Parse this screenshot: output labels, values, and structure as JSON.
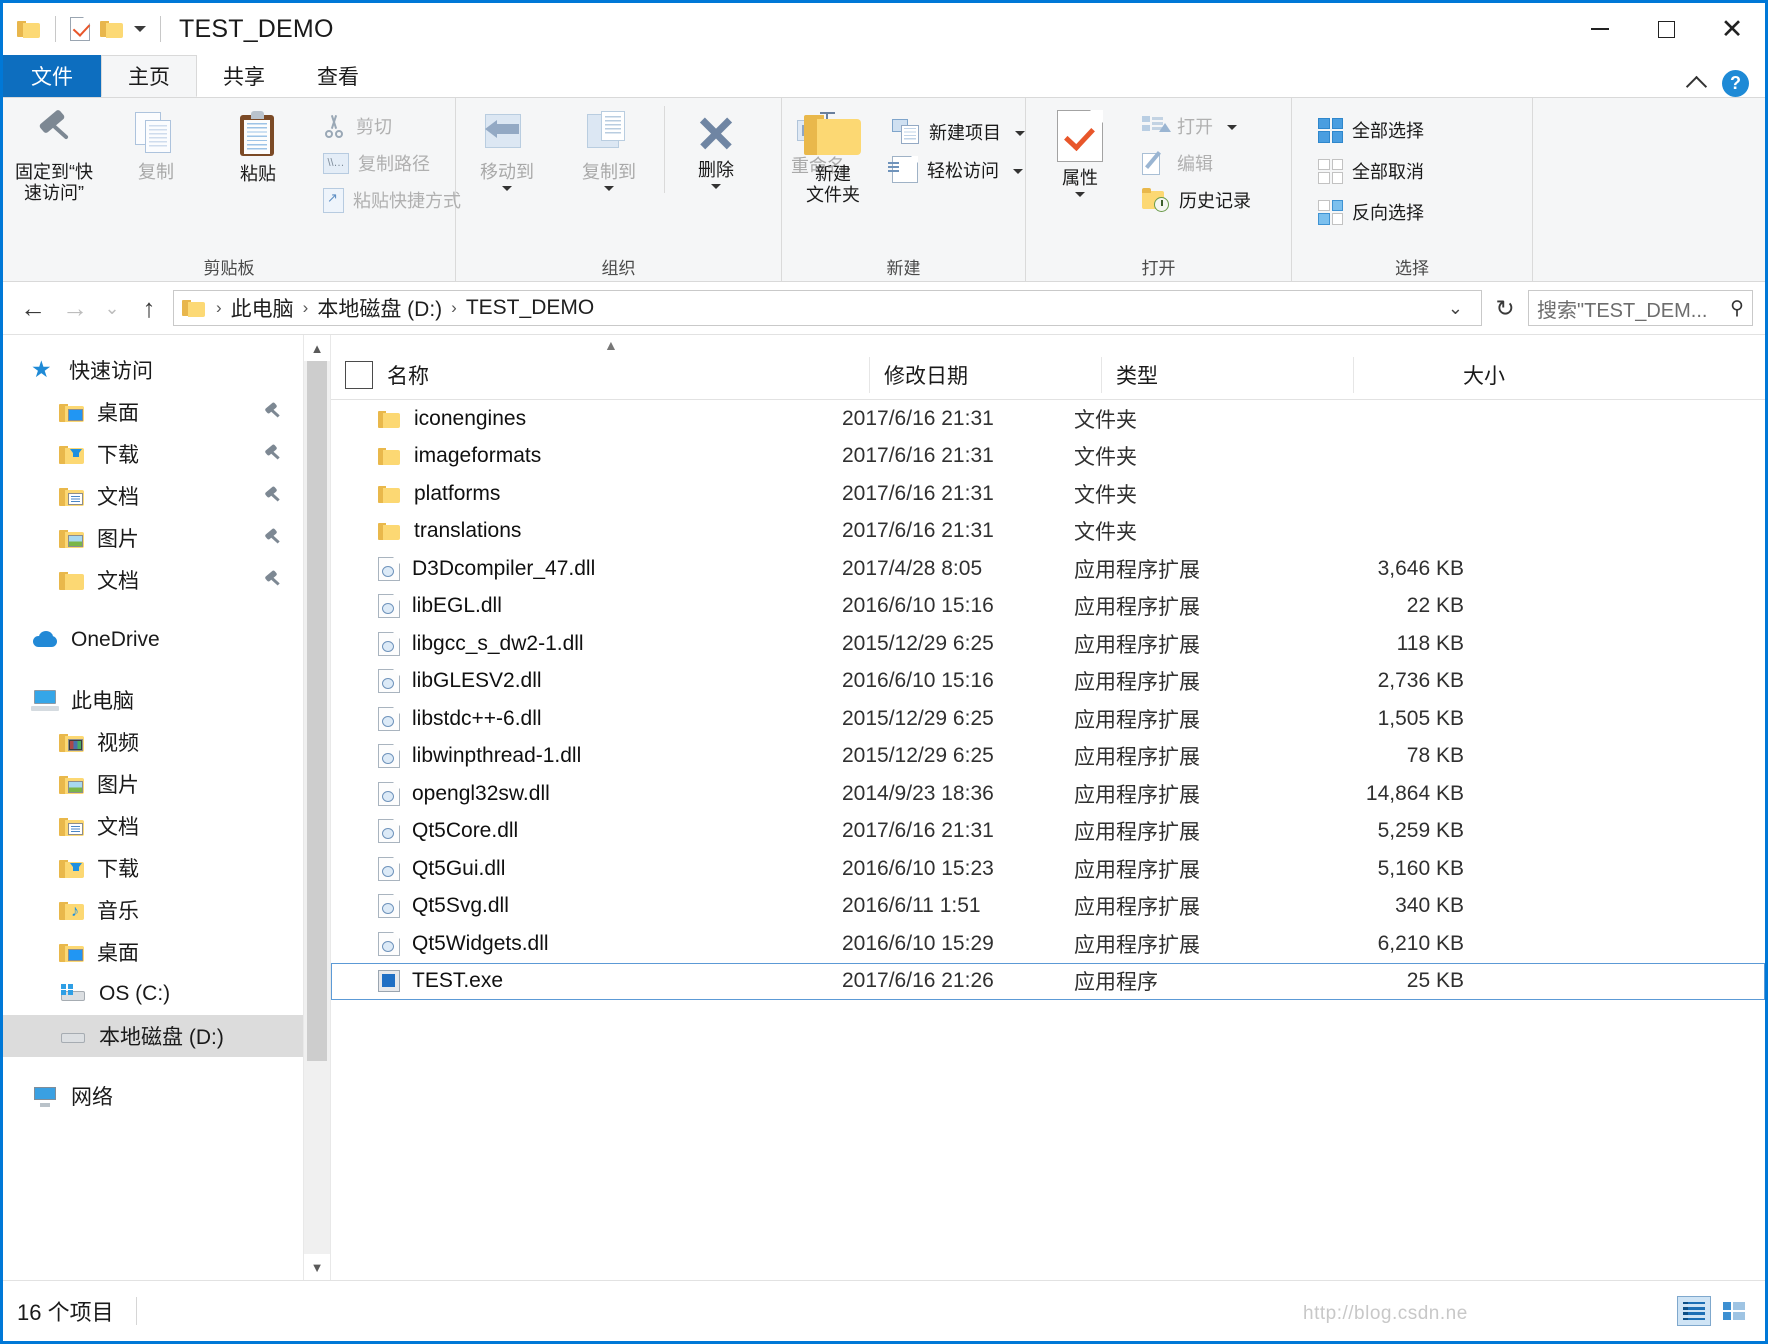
{
  "window": {
    "title": "TEST_DEMO",
    "minimize_label": "最小化",
    "maximize_label": "最大化",
    "close_label": "关闭"
  },
  "quick_access_toolbar": {
    "folder_icon": "folder-icon",
    "properties_icon": "properties-icon",
    "new_folder_icon": "new-folder-icon",
    "customize_label": "▾"
  },
  "tabs": [
    {
      "label": "文件",
      "id": "file"
    },
    {
      "label": "主页",
      "id": "home"
    },
    {
      "label": "共享",
      "id": "share"
    },
    {
      "label": "查看",
      "id": "view"
    }
  ],
  "ribbon": {
    "collapse_icon": "chevron-up-icon",
    "help_icon": "help-icon",
    "help_label": "?",
    "groups": [
      {
        "label": "剪贴板",
        "big_buttons": [
          {
            "label": "固定到“快\n速访问”",
            "line1": "固定到“快",
            "line2": "速访问”",
            "icon": "pin-icon",
            "disabled": false
          },
          {
            "label": "复制",
            "icon": "copy-icon",
            "disabled": true
          },
          {
            "label": "粘贴",
            "icon": "paste-icon",
            "disabled": false
          }
        ],
        "small_buttons": [
          {
            "label": "剪切",
            "icon": "scissors-icon",
            "disabled": true
          },
          {
            "label": "复制路径",
            "icon": "copy-path-icon",
            "disabled": true
          },
          {
            "label": "粘贴快捷方式",
            "icon": "paste-shortcut-icon",
            "disabled": true
          }
        ]
      },
      {
        "label": "组织",
        "big_buttons": [
          {
            "label": "移动到",
            "icon": "move-to-icon",
            "disabled": true,
            "dropdown": true
          },
          {
            "label": "复制到",
            "icon": "copy-to-icon",
            "disabled": true,
            "dropdown": true
          },
          {
            "label": "删除",
            "icon": "delete-icon",
            "disabled": false,
            "dropdown": true
          },
          {
            "label": "重命名",
            "icon": "rename-icon",
            "disabled": true
          }
        ],
        "small_buttons": []
      },
      {
        "label": "新建",
        "big_buttons": [
          {
            "label": "新建\n文件夹",
            "line1": "新建",
            "line2": "文件夹",
            "icon": "new-folder-icon",
            "disabled": false
          }
        ],
        "small_buttons": [
          {
            "label": "新建项目",
            "icon": "new-item-icon",
            "disabled": false,
            "dropdown": true
          },
          {
            "label": "轻松访问",
            "icon": "easy-access-icon",
            "disabled": false,
            "dropdown": true
          }
        ]
      },
      {
        "label": "打开",
        "big_buttons": [
          {
            "label": "属性",
            "icon": "properties-icon",
            "disabled": false,
            "dropdown": true
          }
        ],
        "small_buttons": [
          {
            "label": "打开",
            "icon": "open-icon",
            "disabled": true,
            "dropdown": true
          },
          {
            "label": "编辑",
            "icon": "edit-icon",
            "disabled": true
          },
          {
            "label": "历史记录",
            "icon": "history-icon",
            "disabled": false
          }
        ]
      },
      {
        "label": "选择",
        "big_buttons": [],
        "small_buttons": [
          {
            "label": "全部选择",
            "icon": "select-all-icon",
            "disabled": false
          },
          {
            "label": "全部取消",
            "icon": "select-none-icon",
            "disabled": false
          },
          {
            "label": "反向选择",
            "icon": "invert-selection-icon",
            "disabled": false
          }
        ]
      }
    ]
  },
  "address_bar": {
    "back_icon": "back-arrow-icon",
    "forward_icon": "forward-arrow-icon",
    "recent_icon": "chevron-down-icon",
    "up_icon": "up-arrow-icon",
    "folder_icon": "folder-icon",
    "breadcrumbs": [
      "此电脑",
      "本地磁盘 (D:)",
      "TEST_DEMO"
    ],
    "separator": "›",
    "dropdown_icon": "chevron-down-icon",
    "refresh_icon": "refresh-icon",
    "search_placeholder": "搜索\"TEST_DEM...",
    "search_icon": "search-icon"
  },
  "nav_pane": {
    "scroll_up_icon": "scroll-up-icon",
    "scroll_down_icon": "scroll-down-icon",
    "sections": [
      {
        "header": {
          "label": "快速访问",
          "icon": "star-icon"
        },
        "items": [
          {
            "label": "桌面",
            "icon": "folder-desktop-icon",
            "pinned": true
          },
          {
            "label": "下载",
            "icon": "folder-downloads-icon",
            "pinned": true
          },
          {
            "label": "文档",
            "icon": "folder-documents-icon",
            "pinned": true
          },
          {
            "label": "图片",
            "icon": "folder-pictures-icon",
            "pinned": true
          },
          {
            "label": "文档",
            "icon": "folder-icon",
            "pinned": true
          }
        ]
      },
      {
        "header": {
          "label": "OneDrive",
          "icon": "cloud-icon"
        },
        "items": []
      },
      {
        "header": {
          "label": "此电脑",
          "icon": "computer-icon"
        },
        "items": [
          {
            "label": "视频",
            "icon": "folder-videos-icon",
            "pinned": false
          },
          {
            "label": "图片",
            "icon": "folder-pictures-icon",
            "pinned": false
          },
          {
            "label": "文档",
            "icon": "folder-documents-icon",
            "pinned": false
          },
          {
            "label": "下载",
            "icon": "folder-downloads-icon",
            "pinned": false
          },
          {
            "label": "音乐",
            "icon": "folder-music-icon",
            "pinned": false
          },
          {
            "label": "桌面",
            "icon": "folder-desktop-icon",
            "pinned": false
          },
          {
            "label": "OS (C:)",
            "icon": "drive-os-icon",
            "pinned": false
          },
          {
            "label": "本地磁盘 (D:)",
            "icon": "drive-icon",
            "pinned": false,
            "selected": true
          }
        ]
      },
      {
        "header": {
          "label": "网络",
          "icon": "network-icon"
        },
        "items": []
      }
    ]
  },
  "file_list": {
    "select_all_checkbox": "select-all-checkbox",
    "sort_indicator": "▲",
    "columns": [
      {
        "label": "名称",
        "key": "name"
      },
      {
        "label": "修改日期",
        "key": "date"
      },
      {
        "label": "类型",
        "key": "type"
      },
      {
        "label": "大小",
        "key": "size"
      }
    ],
    "rows": [
      {
        "name": "iconengines",
        "date": "2017/6/16 21:31",
        "type": "文件夹",
        "size": "",
        "icon": "folder-icon",
        "selected": false
      },
      {
        "name": "imageformats",
        "date": "2017/6/16 21:31",
        "type": "文件夹",
        "size": "",
        "icon": "folder-icon",
        "selected": false
      },
      {
        "name": "platforms",
        "date": "2017/6/16 21:31",
        "type": "文件夹",
        "size": "",
        "icon": "folder-icon",
        "selected": false
      },
      {
        "name": "translations",
        "date": "2017/6/16 21:31",
        "type": "文件夹",
        "size": "",
        "icon": "folder-icon",
        "selected": false
      },
      {
        "name": "D3Dcompiler_47.dll",
        "date": "2017/4/28 8:05",
        "type": "应用程序扩展",
        "size": "3,646 KB",
        "icon": "dll-icon",
        "selected": false
      },
      {
        "name": "libEGL.dll",
        "date": "2016/6/10 15:16",
        "type": "应用程序扩展",
        "size": "22 KB",
        "icon": "dll-icon",
        "selected": false
      },
      {
        "name": "libgcc_s_dw2-1.dll",
        "date": "2015/12/29 6:25",
        "type": "应用程序扩展",
        "size": "118 KB",
        "icon": "dll-icon",
        "selected": false
      },
      {
        "name": "libGLESV2.dll",
        "date": "2016/6/10 15:16",
        "type": "应用程序扩展",
        "size": "2,736 KB",
        "icon": "dll-icon",
        "selected": false
      },
      {
        "name": "libstdc++-6.dll",
        "date": "2015/12/29 6:25",
        "type": "应用程序扩展",
        "size": "1,505 KB",
        "icon": "dll-icon",
        "selected": false
      },
      {
        "name": "libwinpthread-1.dll",
        "date": "2015/12/29 6:25",
        "type": "应用程序扩展",
        "size": "78 KB",
        "icon": "dll-icon",
        "selected": false
      },
      {
        "name": "opengl32sw.dll",
        "date": "2014/9/23 18:36",
        "type": "应用程序扩展",
        "size": "14,864 KB",
        "icon": "dll-icon",
        "selected": false
      },
      {
        "name": "Qt5Core.dll",
        "date": "2017/6/16 21:31",
        "type": "应用程序扩展",
        "size": "5,259 KB",
        "icon": "dll-icon",
        "selected": false
      },
      {
        "name": "Qt5Gui.dll",
        "date": "2016/6/10 15:23",
        "type": "应用程序扩展",
        "size": "5,160 KB",
        "icon": "dll-icon",
        "selected": false
      },
      {
        "name": "Qt5Svg.dll",
        "date": "2016/6/11 1:51",
        "type": "应用程序扩展",
        "size": "340 KB",
        "icon": "dll-icon",
        "selected": false
      },
      {
        "name": "Qt5Widgets.dll",
        "date": "2016/6/10 15:29",
        "type": "应用程序扩展",
        "size": "6,210 KB",
        "icon": "dll-icon",
        "selected": false
      },
      {
        "name": "TEST.exe",
        "date": "2017/6/16 21:26",
        "type": "应用程序",
        "size": "25 KB",
        "icon": "exe-icon",
        "selected": true
      }
    ]
  },
  "status_bar": {
    "item_count": "16 个项目",
    "watermark": "http://blog.csdn.ne",
    "details_view_icon": "details-view-icon",
    "tiles_view_icon": "large-icons-view-icon"
  },
  "colors": {
    "accent": "#0078d7",
    "file_tab": "#0d6ebf",
    "selection": "#dcdcdc",
    "row_selected_border": "#5c9ad6",
    "folder_yellow": "#fcd873"
  }
}
